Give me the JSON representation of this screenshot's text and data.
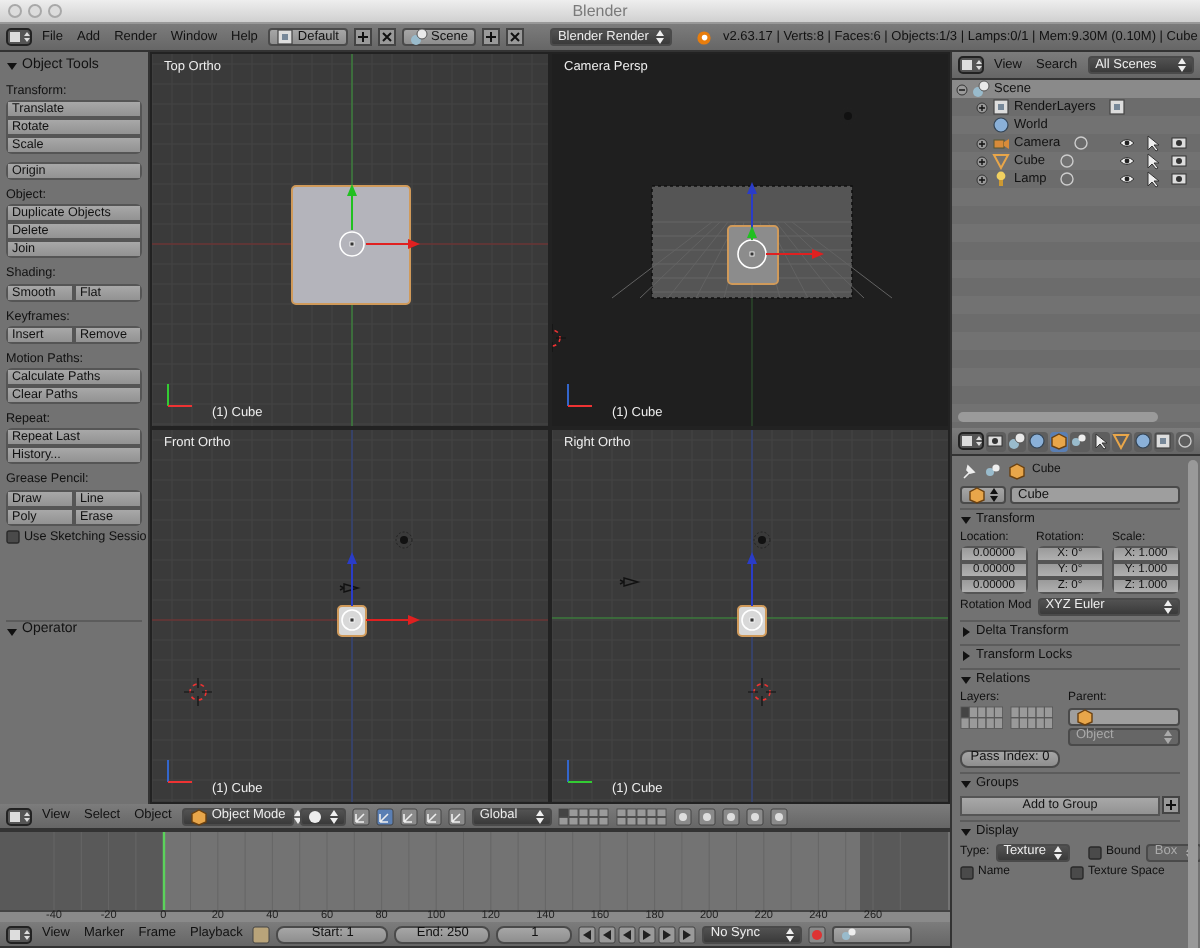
{
  "window": {
    "title": "Blender"
  },
  "info_header": {
    "menus": [
      "File",
      "Add",
      "Render",
      "Window",
      "Help"
    ],
    "layout": "Default",
    "scene": "Scene",
    "engine": "Blender Render",
    "stats": "v2.63.17 | Verts:8 | Faces:6 | Objects:1/3 | Lamps:0/1 | Mem:9.30M (0.10M) | Cube"
  },
  "tool_shelf": {
    "title": "Object Tools",
    "expanded": true,
    "groups": [
      {
        "label": "Transform:",
        "rows": [
          [
            "Translate"
          ],
          [
            "Rotate"
          ],
          [
            "Scale"
          ]
        ]
      },
      {
        "rows": [
          [
            "Origin"
          ]
        ]
      },
      {
        "label": "Object:",
        "rows": [
          [
            "Duplicate Objects"
          ],
          [
            "Delete"
          ],
          [
            "Join"
          ]
        ]
      },
      {
        "label": "Shading:",
        "rows": [
          [
            "Smooth",
            "Flat"
          ]
        ]
      },
      {
        "label": "Keyframes:",
        "rows": [
          [
            "Insert",
            "Remove"
          ]
        ]
      },
      {
        "label": "Motion Paths:",
        "rows": [
          [
            "Calculate Paths"
          ],
          [
            "Clear Paths"
          ]
        ]
      },
      {
        "label": "Repeat:",
        "rows": [
          [
            "Repeat Last"
          ],
          [
            "History..."
          ]
        ]
      },
      {
        "label": "Grease Pencil:",
        "rows": [
          [
            "Draw",
            "Line"
          ],
          [
            "Poly",
            "Erase"
          ]
        ]
      }
    ],
    "checkbox": {
      "label": "Use Sketching Sessio",
      "checked": false
    },
    "operator": {
      "title": "Operator",
      "expanded": true
    }
  },
  "viewports": [
    {
      "kind": "top",
      "title": "Top Ortho",
      "object_label": "(1) Cube"
    },
    {
      "kind": "camera",
      "title": "Camera Persp",
      "object_label": "(1) Cube"
    },
    {
      "kind": "front",
      "title": "Front Ortho",
      "object_label": "(1) Cube"
    },
    {
      "kind": "right",
      "title": "Right Ortho",
      "object_label": "(1) Cube"
    }
  ],
  "view3d_header": {
    "menus": [
      "View",
      "Select",
      "Object"
    ],
    "mode": "Object Mode",
    "orientation": "Global"
  },
  "timeline": {
    "ruler_ticks": [
      "-40",
      "-20",
      "0",
      "20",
      "40",
      "60",
      "80",
      "100",
      "120",
      "140",
      "160",
      "180",
      "200",
      "220",
      "240",
      "260"
    ],
    "menus": [
      "View",
      "Marker",
      "Frame",
      "Playback"
    ],
    "start": "Start: 1",
    "end": "End: 250",
    "current": "1",
    "sync": "No Sync"
  },
  "outliner": {
    "menus": [
      "View",
      "Search"
    ],
    "filter": "All Scenes",
    "tree": [
      {
        "kind": "scene",
        "label": "Scene",
        "expanded": true,
        "children": [
          {
            "kind": "render_layers",
            "label": "RenderLayers",
            "expanded": false
          },
          {
            "kind": "world",
            "label": "World"
          },
          {
            "kind": "camera",
            "label": "Camera",
            "expanded": false
          },
          {
            "kind": "mesh",
            "label": "Cube",
            "expanded": false
          },
          {
            "kind": "lamp",
            "label": "Lamp",
            "expanded": false
          }
        ]
      }
    ]
  },
  "properties": {
    "tabs": [
      {
        "selected": false
      },
      {
        "selected": false
      },
      {
        "selected": false
      },
      {
        "selected": true
      },
      {
        "selected": false
      },
      {
        "selected": false
      },
      {
        "selected": false
      },
      {
        "selected": false
      },
      {
        "selected": false
      },
      {
        "selected": false
      }
    ],
    "context_label": "Cube",
    "name": "Cube",
    "transform": {
      "title": "Transform",
      "expanded": true,
      "columns": [
        {
          "label": "Location:",
          "values": [
            "0.00000",
            "0.00000",
            "0.00000"
          ]
        },
        {
          "label": "Rotation:",
          "values": [
            "X: 0°",
            "Y: 0°",
            "Z: 0°"
          ]
        },
        {
          "label": "Scale:",
          "values": [
            "X: 1.000",
            "Y: 1.000",
            "Z: 1.000"
          ]
        }
      ],
      "rotation_mode_label": "Rotation Mod",
      "rotation_mode": "XYZ Euler"
    },
    "collapsed": [
      {
        "title": "Delta Transform",
        "expanded": false
      },
      {
        "title": "Transform Locks",
        "expanded": false
      }
    ],
    "relations": {
      "title": "Relations",
      "expanded": true,
      "layers_label": "Layers:",
      "parent_label": "Parent:",
      "parent_type": "Object",
      "pass_index": "Pass Index: 0"
    },
    "groups": {
      "title": "Groups",
      "expanded": true,
      "button": "Add to Group"
    },
    "display": {
      "title": "Display",
      "expanded": true,
      "type_label": "Type:",
      "type": "Texture",
      "bound": {
        "label": "Bound",
        "checked": false
      },
      "bound_type": "Box",
      "checkboxes": [
        {
          "label": "Name",
          "checked": false
        },
        {
          "label": "Texture Space",
          "checked": false
        }
      ]
    }
  }
}
